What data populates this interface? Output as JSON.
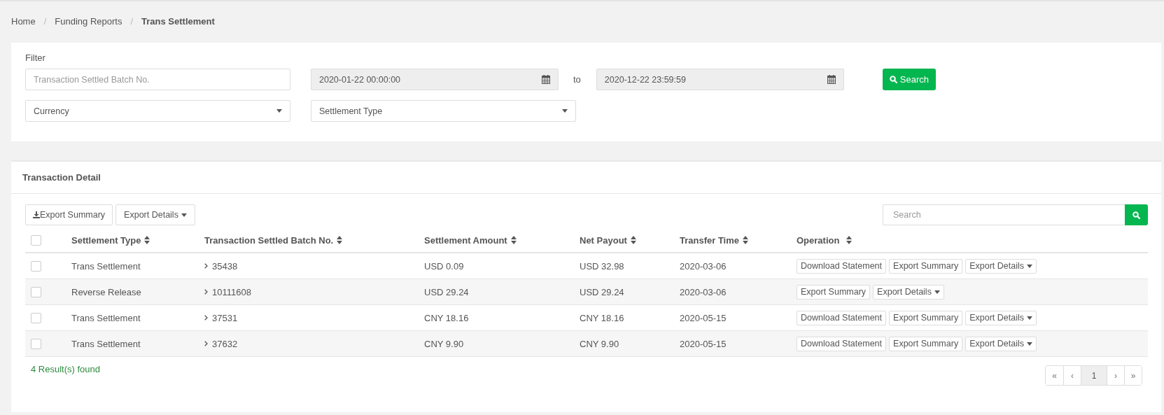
{
  "breadcrumb": [
    {
      "label": "Home",
      "current": false
    },
    {
      "separator": "/",
      "label": "Funding Reports",
      "current": false
    },
    {
      "separator": "/",
      "label": "Trans Settlement",
      "current": true
    }
  ],
  "filter": {
    "title": "Filter",
    "batch_field": {
      "placeholder": "Transaction Settled Batch No."
    },
    "date_from": {
      "value": "2020-01-22 00:00:00"
    },
    "to_label": "to",
    "date_to": {
      "value": "2020-12-22 23:59:59"
    },
    "search_button": "Search",
    "currency_select": {
      "placeholder": "Currency"
    },
    "settlement_type_select": {
      "placeholder": "Settlement Type"
    }
  },
  "detail": {
    "title": "Transaction Detail",
    "export_summary_button": "Export Summary",
    "export_details_button": "Export Details",
    "search": {
      "placeholder": "Search"
    },
    "table": {
      "all_checked": false,
      "columns": [
        "Settlement Type",
        "Transaction Settled Batch No.",
        "Settlement Amount",
        "Net Payout",
        "Transfer Time",
        "Operation"
      ],
      "rows": [
        {
          "checked": false,
          "settlement_type": "Trans Settlement",
          "batch_no": "35438",
          "settlement_amount": "USD 0.09",
          "net_payout": "USD 32.98",
          "transfer_time": "2020-03-06",
          "operations": [
            {
              "label": "Download Statement",
              "kind": "button"
            },
            {
              "label": "Export Summary",
              "kind": "button"
            },
            {
              "label": "Export Details",
              "kind": "dropdown"
            }
          ]
        },
        {
          "checked": false,
          "settlement_type": "Reverse Release",
          "batch_no": "10111608",
          "settlement_amount": "USD 29.24",
          "net_payout": "USD 29.24",
          "transfer_time": "2020-03-06",
          "operations": [
            {
              "label": "Export Summary",
              "kind": "button"
            },
            {
              "label": "Export Details",
              "kind": "dropdown"
            }
          ]
        },
        {
          "checked": false,
          "settlement_type": "Trans Settlement",
          "batch_no": "37531",
          "settlement_amount": "CNY 18.16",
          "net_payout": "CNY 18.16",
          "transfer_time": "2020-05-15",
          "operations": [
            {
              "label": "Download Statement",
              "kind": "button"
            },
            {
              "label": "Export Summary",
              "kind": "button"
            },
            {
              "label": "Export Details",
              "kind": "dropdown"
            }
          ]
        },
        {
          "checked": false,
          "settlement_type": "Trans Settlement",
          "batch_no": "37632",
          "settlement_amount": "CNY 9.90",
          "net_payout": "CNY 9.90",
          "transfer_time": "2020-05-15",
          "operations": [
            {
              "label": "Download Statement",
              "kind": "button"
            },
            {
              "label": "Export Summary",
              "kind": "button"
            },
            {
              "label": "Export Details",
              "kind": "dropdown"
            }
          ]
        }
      ]
    },
    "result_count": "4 Result(s) found",
    "pagination": [
      {
        "label": "«",
        "selected": false
      },
      {
        "label": "‹",
        "selected": false
      },
      {
        "label": "1",
        "selected": true
      },
      {
        "label": "›",
        "selected": false
      },
      {
        "label": "»",
        "selected": false
      }
    ]
  }
}
